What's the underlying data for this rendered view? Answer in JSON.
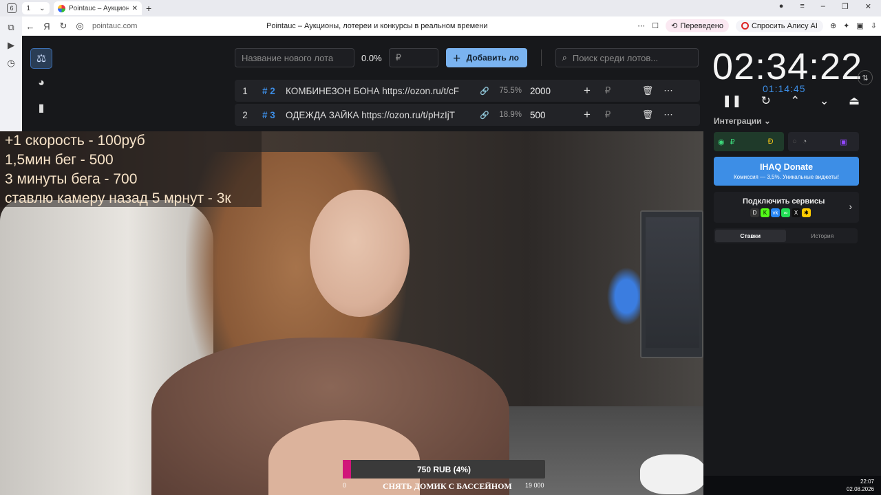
{
  "browser": {
    "tab_count": "6",
    "tab_title": "Pointauc – Аукционы, л",
    "address": "pointauc.com",
    "page_title": "Pointauc – Аукционы, лотереи и конкурсы в реальном времени",
    "translated_label": "Переведено",
    "alisa_label": "Спросить Алису AI"
  },
  "toolbar": {
    "new_lot_placeholder": "Название нового лота",
    "percent": "0.0%",
    "amount_placeholder": "₽",
    "add_lot_label": "Добавить ло",
    "search_placeholder": "Поиск среди лотов..."
  },
  "lots": [
    {
      "num": "1",
      "id": "# 2",
      "name": "КОМБИНЕЗОН БОНА https://ozon.ru/t/cF",
      "percent": "75.5%",
      "amount": "2000"
    },
    {
      "num": "2",
      "id": "# 3",
      "name": "ОДЕЖДА ЗАЙКА https://ozon.ru/t/pHzIjT",
      "percent": "18.9%",
      "amount": "500"
    }
  ],
  "timer": {
    "main": "02:34:22",
    "sub": "01:14:45"
  },
  "integrations": {
    "label": "Интеграции",
    "donate_title": "IHAQ Donate",
    "donate_sub": "Комиссия — 3,5%. Уникальные виджеты!",
    "connect_label": "Подключить сервисы",
    "tab_bets": "Ставки",
    "tab_history": "История"
  },
  "overlay_lines": [
    "+1 скорость - 100руб",
    "1,5мин бег - 500",
    "3 минуты бега - 700",
    "ставлю камеру назад 5 мрнут - 3к"
  ],
  "goal": {
    "text": "750 RUB (4%)",
    "progress": 0.04,
    "min": "0",
    "max": "19 000",
    "name": "СНЯТЬ ДОМИК С БАССЕЙНОМ"
  },
  "system_clock": {
    "time": "22:07",
    "date": "02.08.2026"
  },
  "colors": {
    "accent": "#3d8ee6",
    "add_button": "#7ab3f0",
    "goal_fill": "#d1167a",
    "background": "#17181b"
  }
}
